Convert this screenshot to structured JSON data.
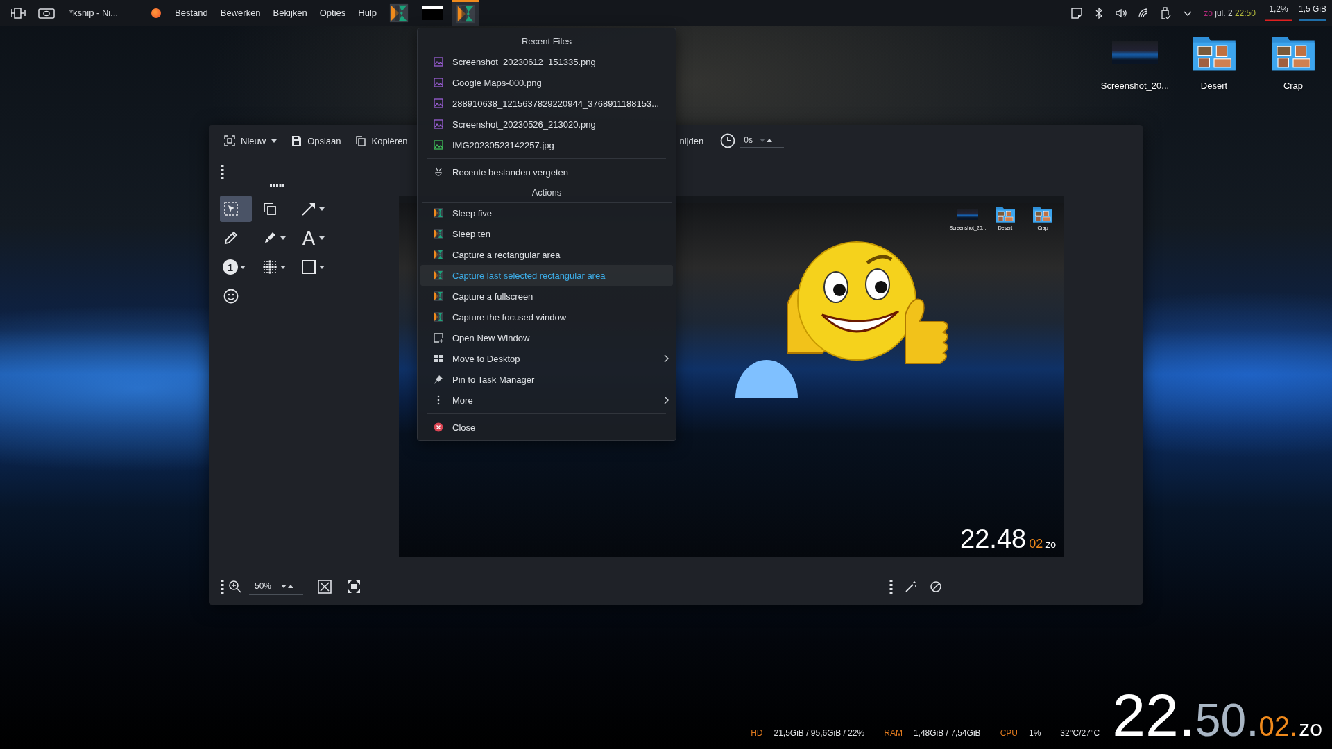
{
  "panel": {
    "title": "*ksnip - Ni...",
    "menus": [
      "Bestand",
      "Bewerken",
      "Bekijken",
      "Opties",
      "Hulp"
    ],
    "tasks": [
      {
        "kind": "ksnip",
        "selected": false
      },
      {
        "kind": "window",
        "selected": false
      },
      {
        "kind": "ksnip",
        "selected": true
      }
    ],
    "tray": {
      "day": "zo",
      "date": "jul. 2",
      "time": "22:50",
      "cpu": "1,2%",
      "memory": "1,5 GiB"
    }
  },
  "desktop_icons": [
    {
      "kind": "thumbnail",
      "label": "Screenshot_20..."
    },
    {
      "kind": "folder",
      "label": "Desert"
    },
    {
      "kind": "folder",
      "label": "Crap"
    }
  ],
  "window": {
    "toolbar": [
      {
        "kind": "new",
        "label": "Nieuw",
        "dropdown": true
      },
      {
        "kind": "save",
        "label": "Opslaan",
        "dropdown": false
      },
      {
        "kind": "copy",
        "label": "Kopiëren",
        "dropdown": false
      },
      {
        "kind": "covered",
        "label": "nijden",
        "dropdown": false
      }
    ],
    "delay": {
      "value": "0s"
    },
    "tools": [
      {
        "kind": "select",
        "selected": true,
        "dropdown": false
      },
      {
        "kind": "duplicate",
        "selected": false,
        "dropdown": false
      },
      {
        "kind": "arrow",
        "selected": false,
        "dropdown": true
      },
      {
        "kind": "pen",
        "selected": false,
        "dropdown": false
      },
      {
        "kind": "marker",
        "selected": false,
        "dropdown": true
      },
      {
        "kind": "text",
        "label": "A",
        "selected": false,
        "dropdown": true
      },
      {
        "kind": "number",
        "label": "1",
        "selected": false,
        "dropdown": true
      },
      {
        "kind": "blur",
        "selected": false,
        "dropdown": true
      },
      {
        "kind": "rect",
        "selected": false,
        "dropdown": true
      },
      {
        "kind": "sticker",
        "selected": false,
        "dropdown": false
      }
    ],
    "preview": {
      "icons": [
        {
          "kind": "thumbnail",
          "label": "Screenshot_20..."
        },
        {
          "kind": "folder",
          "label": "Desert"
        },
        {
          "kind": "folder",
          "label": "Crap"
        }
      ],
      "clock": {
        "hours": "22.",
        "minutes": "48",
        "seconds": "02",
        "day": "zo"
      }
    },
    "zoom": {
      "value": "50%"
    }
  },
  "menu": {
    "groups": [
      {
        "header": "Recent Files",
        "items": [
          {
            "kind": "image",
            "label": "Screenshot_20230612_151335.png",
            "submenu": false,
            "selected": false
          },
          {
            "kind": "image",
            "label": "Google Maps-000.png",
            "submenu": false,
            "selected": false
          },
          {
            "kind": "image",
            "label": "288910638_1215637829220944_3768911188153...",
            "submenu": false,
            "selected": false
          },
          {
            "kind": "image",
            "label": "Screenshot_20230526_213020.png",
            "submenu": false,
            "selected": false
          },
          {
            "kind": "photo",
            "label": "IMG20230523142257.jpg",
            "submenu": false,
            "selected": false
          }
        ]
      },
      {
        "items": [
          {
            "kind": "broom",
            "label": "Recente bestanden vergeten",
            "submenu": false,
            "selected": false
          }
        ]
      },
      {
        "header": "Actions",
        "items": [
          {
            "kind": "ksnip",
            "label": "Sleep five",
            "submenu": false,
            "selected": false
          },
          {
            "kind": "ksnip",
            "label": "Sleep ten",
            "submenu": false,
            "selected": false
          },
          {
            "kind": "ksnip",
            "label": "Capture a rectangular area",
            "submenu": false,
            "selected": false
          },
          {
            "kind": "ksnip",
            "label": "Capture last selected rectangular area",
            "submenu": false,
            "selected": true
          },
          {
            "kind": "ksnip",
            "label": "Capture a fullscreen",
            "submenu": false,
            "selected": false
          },
          {
            "kind": "ksnip",
            "label": "Capture the focused window",
            "submenu": false,
            "selected": false
          },
          {
            "kind": "window",
            "label": "Open New Window",
            "submenu": false,
            "selected": false
          },
          {
            "kind": "grid",
            "label": "Move to Desktop",
            "submenu": true,
            "selected": false
          },
          {
            "kind": "pin",
            "label": "Pin to Task Manager",
            "submenu": false,
            "selected": false
          },
          {
            "kind": "dots",
            "label": "More",
            "submenu": true,
            "selected": false
          }
        ]
      },
      {
        "items": [
          {
            "kind": "close",
            "label": "Close",
            "submenu": false,
            "selected": false
          }
        ]
      }
    ]
  },
  "stats": [
    {
      "label": "HD",
      "value": "21,5GiB / 95,6GiB / 22%"
    },
    {
      "label": "RAM",
      "value": "1,48GiB / 7,54GiB"
    },
    {
      "label": "CPU",
      "value": "1%"
    }
  ],
  "temperature": "32°C/27°C",
  "clock": {
    "hours": "22.",
    "minutes": "50.",
    "seconds": "02.",
    "day": "zo"
  }
}
